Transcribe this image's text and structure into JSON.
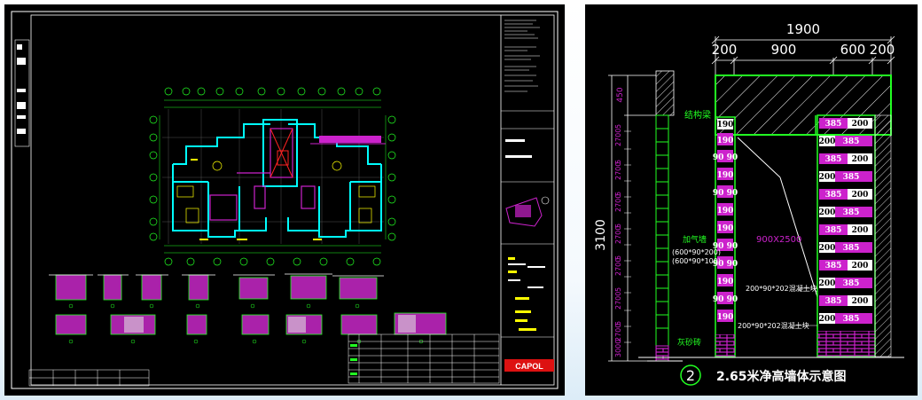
{
  "overview": {
    "drawing_title": "CAD floor plan sheet",
    "logo_text": "CAPOL"
  },
  "detail": {
    "dim_total": "1900",
    "dims_top": [
      "200",
      "900",
      "600",
      "200"
    ],
    "dim_left_top": "450",
    "dim_left_total": "3100",
    "label_beam": "结构梁",
    "label_wall_1": "加气墙",
    "label_wall_2": "(600*90*200)",
    "label_wall_3": "(600*90*100)",
    "label_opening": "900X2500",
    "label_block_1": "200*90*202混凝土块",
    "label_block_2": "200*90*202混凝土块",
    "label_bottom_left": "灰砂砖",
    "caption_number": "2",
    "caption_text": "2.65米净高墙体示意图",
    "small_dims_left": [
      "5",
      "2",
      "5",
      "2",
      "5",
      "2",
      "5",
      "2",
      "5",
      "2",
      "5",
      "2",
      "5",
      "2",
      "5",
      "2",
      "5",
      "2",
      "5",
      "2",
      "5",
      "2"
    ],
    "vals_190": "190",
    "vals_9090": "90 90",
    "vals_385": "385",
    "vals_200": "200"
  },
  "colors": {
    "green": "#22ff22",
    "magenta": "#cc22cc",
    "white": "#ffffff",
    "yellow": "#ffff00",
    "cyan": "#00ffff",
    "red": "#ff2222"
  }
}
